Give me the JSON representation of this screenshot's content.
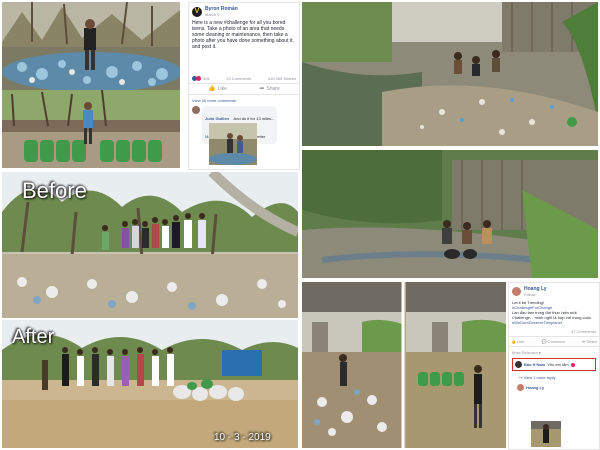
{
  "post1": {
    "author": "Byron Román",
    "timestamp": "March 5",
    "body": "Here is a new #challenge for all you bored teens. Take a photo of an area that needs some cleaning or maintenance, then take a photo after you have done something about it, and post it.",
    "reactions_count": "306",
    "comments_count": "22 Comments",
    "shares_count": "310,469 Shares",
    "like_label": "Like",
    "share_label": "Share",
    "view_more": "View 16 more comments",
    "commenter": "Julio Guillen",
    "comment_text": "And do it for 13 miles...",
    "tagged_name": "Manuel Saldana",
    "tagged_suffix": "the trend setter"
  },
  "panel2": {
    "before_label": "Before",
    "after_label": "After",
    "date_stamp": "10 - 3 - 2019"
  },
  "post2": {
    "author": "Hoang Ly",
    "follow_label": "Follow",
    "intro": "Let it be Trending!",
    "tag1": "#ChallengeForChange",
    "vietnamese_text": "Lần đầu làm trong đời thực hiện một Challenge... mình nghĩ là hợp với trong cuộc sống",
    "tag2": "#WeDontDeserveThisplanet",
    "reactions_count": "47 Comments",
    "like_label": "Like",
    "comment_label": "Comment",
    "share_label": "Share",
    "most_relevant": "Most Relevant",
    "highlight_name": "Bảo K'Nam",
    "highlight_text": "Yêu em lắm",
    "view_replies": "View 1 more reply",
    "reply_author": "Hoang Ly"
  },
  "colors": {
    "fb_blue": "#385898",
    "highlight_red": "#d32f2f",
    "trash_blue": "#6fa8c8",
    "bag_green": "#3f9b4a"
  }
}
